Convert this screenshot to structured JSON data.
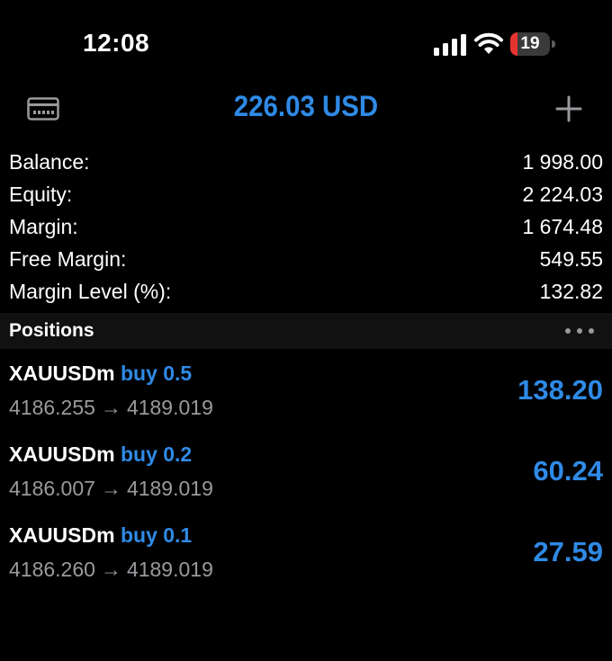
{
  "status_bar": {
    "time": "12:08",
    "battery_level": "19",
    "battery_fraction": 0.19,
    "battery_color": "#e5342f"
  },
  "header": {
    "title": "226.03 USD",
    "left_icon": "card-icon",
    "right_icon": "plus-icon"
  },
  "summary": [
    {
      "label": "Balance:",
      "value": "1 998.00"
    },
    {
      "label": "Equity:",
      "value": "2 224.03"
    },
    {
      "label": "Margin:",
      "value": "1 674.48"
    },
    {
      "label": "Free Margin:",
      "value": "549.55"
    },
    {
      "label": "Margin Level (%):",
      "value": "132.82"
    }
  ],
  "positions": {
    "title": "Positions",
    "more_icon": "more-icon",
    "items": [
      {
        "symbol": "XAUUSDm",
        "side": "buy",
        "volume": "0.5",
        "open_price": "4186.255",
        "arrow": "→",
        "current_price": "4189.019",
        "profit": "138.20"
      },
      {
        "symbol": "XAUUSDm",
        "side": "buy",
        "volume": "0.2",
        "open_price": "4186.007",
        "arrow": "→",
        "current_price": "4189.019",
        "profit": "60.24"
      },
      {
        "symbol": "XAUUSDm",
        "side": "buy",
        "volume": "0.1",
        "open_price": "4186.260",
        "arrow": "→",
        "current_price": "4189.019",
        "profit": "27.59"
      }
    ]
  },
  "colors": {
    "accent": "#2f8ae6",
    "background": "#000000",
    "secondary_text": "#9a9a9e"
  }
}
